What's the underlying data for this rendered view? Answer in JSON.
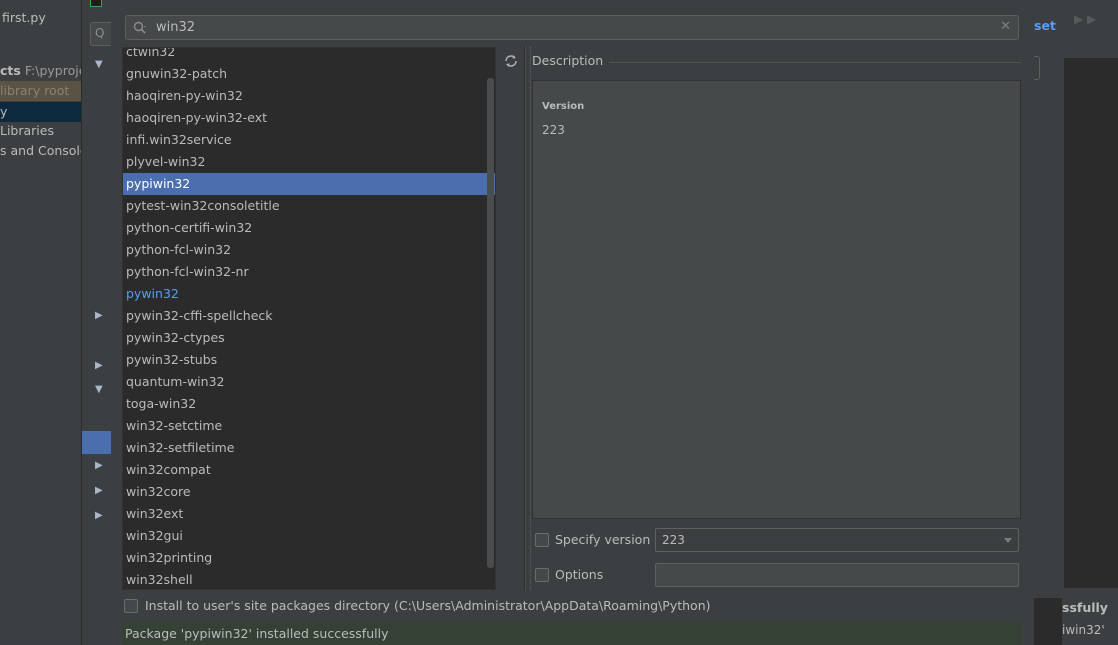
{
  "background_ide": {
    "file_tab": "first.py",
    "tree_projects_bold": "cts",
    "tree_projects_path": "F:\\pyproje",
    "tree_library_root": "library root",
    "tree_external_libraries": "Libraries",
    "tree_scratches": "s and Console"
  },
  "background_dialog": {
    "right_link": "set",
    "notification_title": "ssfully",
    "notification_body": "iwin32'"
  },
  "search": {
    "value": "win32"
  },
  "packages": [
    {
      "name": "ctwin32"
    },
    {
      "name": "gnuwin32-patch"
    },
    {
      "name": "haoqiren-py-win32"
    },
    {
      "name": "haoqiren-py-win32-ext"
    },
    {
      "name": "infi.win32service"
    },
    {
      "name": "plyvel-win32"
    },
    {
      "name": "pypiwin32",
      "selected": true
    },
    {
      "name": "pytest-win32consoletitle"
    },
    {
      "name": "python-certifi-win32"
    },
    {
      "name": "python-fcl-win32"
    },
    {
      "name": "python-fcl-win32-nr"
    },
    {
      "name": "pywin32",
      "installed": true
    },
    {
      "name": "pywin32-cffi-spellcheck"
    },
    {
      "name": "pywin32-ctypes"
    },
    {
      "name": "pywin32-stubs"
    },
    {
      "name": "quantum-win32"
    },
    {
      "name": "toga-win32"
    },
    {
      "name": "win32-setctime"
    },
    {
      "name": "win32-setfiletime"
    },
    {
      "name": "win32compat"
    },
    {
      "name": "win32core"
    },
    {
      "name": "win32ext"
    },
    {
      "name": "win32gui"
    },
    {
      "name": "win32printing"
    },
    {
      "name": "win32shell"
    }
  ],
  "description": {
    "title": "Description",
    "version_label": "Version",
    "version_value": "223"
  },
  "options": {
    "specify_version_label": "Specify version",
    "specify_version_checked": false,
    "version_select_value": "223",
    "options_label": "Options",
    "options_checked": false,
    "options_value": ""
  },
  "install_user_site": {
    "label": "Install to user's site packages directory (C:\\Users\\Administrator\\AppData\\Roaming\\Python)",
    "checked": false
  },
  "status": {
    "message": "Package 'pypiwin32' installed successfully"
  },
  "colors": {
    "selection": "#4b6eaf",
    "installed_text": "#589df6",
    "success_bg": "#344134"
  }
}
